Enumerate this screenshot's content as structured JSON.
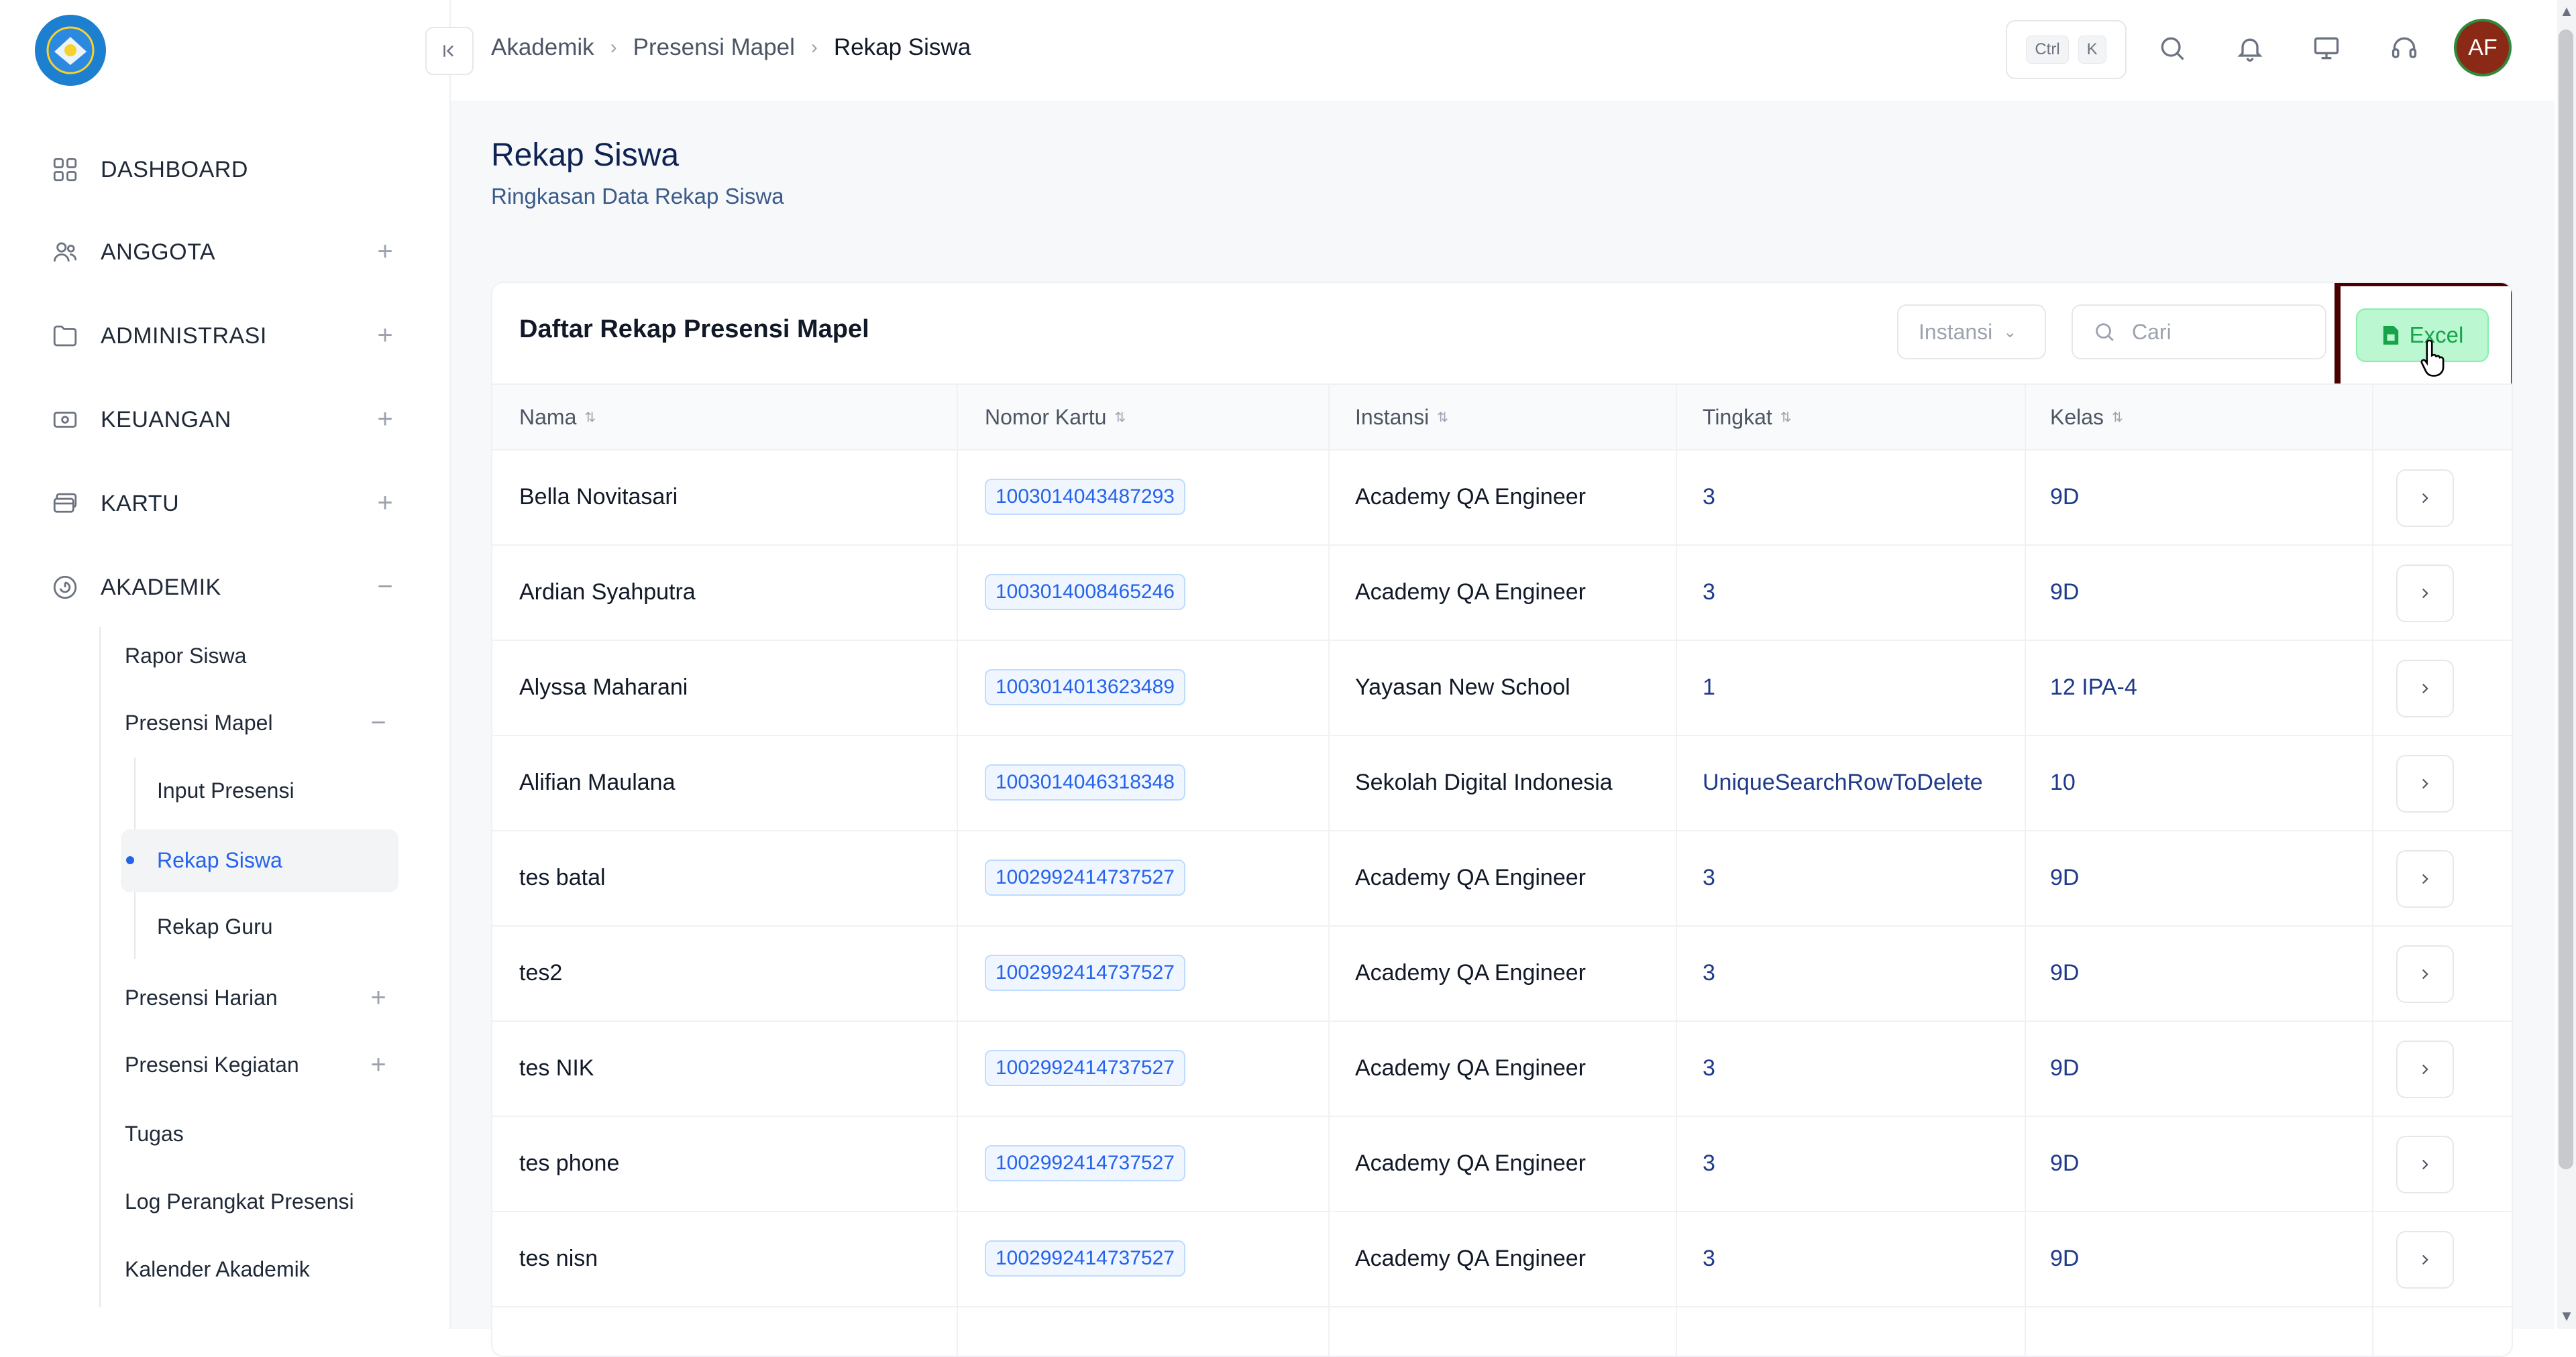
{
  "breadcrumb": [
    "Akademik",
    "Presensi Mapel",
    "Rekap Siswa"
  ],
  "topbar": {
    "kbd_ctrl": "Ctrl",
    "kbd_k": "K",
    "avatar_initials": "AF"
  },
  "sidebar": {
    "items": [
      {
        "label": "DASHBOARD",
        "icon": "grid-icon"
      },
      {
        "label": "ANGGOTA",
        "icon": "users-icon",
        "expand": "+"
      },
      {
        "label": "ADMINISTRASI",
        "icon": "folder-icon",
        "expand": "+"
      },
      {
        "label": "KEUANGAN",
        "icon": "money-icon",
        "expand": "+"
      },
      {
        "label": "KARTU",
        "icon": "card-icon",
        "expand": "+"
      },
      {
        "label": "AKADEMIK",
        "icon": "academic-icon",
        "expand": "−"
      }
    ],
    "akademik_sub": [
      {
        "label": "Rapor Siswa"
      },
      {
        "label": "Presensi Mapel",
        "expand": "−"
      },
      {
        "label": "Presensi Harian",
        "expand": "+"
      },
      {
        "label": "Presensi Kegiatan",
        "expand": "+"
      },
      {
        "label": "Tugas"
      },
      {
        "label": "Log Perangkat Presensi"
      },
      {
        "label": "Kalender Akademik"
      }
    ],
    "presensi_mapel_sub": [
      {
        "label": "Input Presensi"
      },
      {
        "label": "Rekap Siswa",
        "active": true
      },
      {
        "label": "Rekap Guru"
      }
    ]
  },
  "page": {
    "title": "Rekap Siswa",
    "subtitle": "Ringkasan Data Rekap Siswa"
  },
  "card": {
    "title": "Daftar Rekap Presensi Mapel",
    "filter_placeholder": "Instansi",
    "search_placeholder": "Cari",
    "excel_label": "Excel"
  },
  "table": {
    "columns": [
      "Nama",
      "Nomor Kartu",
      "Instansi",
      "Tingkat",
      "Kelas"
    ],
    "rows": [
      {
        "nama": "Bella Novitasari",
        "nomor_kartu": "1003014043487293",
        "instansi": "Academy QA Engineer",
        "tingkat": "3",
        "kelas": "9D"
      },
      {
        "nama": "Ardian Syahputra",
        "nomor_kartu": "1003014008465246",
        "instansi": "Academy QA Engineer",
        "tingkat": "3",
        "kelas": "9D"
      },
      {
        "nama": "Alyssa Maharani",
        "nomor_kartu": "1003014013623489",
        "instansi": "Yayasan New School",
        "tingkat": "1",
        "kelas": "12 IPA-4"
      },
      {
        "nama": "Alifian Maulana",
        "nomor_kartu": "1003014046318348",
        "instansi": "Sekolah Digital Indonesia",
        "tingkat": "UniqueSearchRowToDelete",
        "kelas": "10"
      },
      {
        "nama": "tes batal",
        "nomor_kartu": "1002992414737527",
        "instansi": "Academy QA Engineer",
        "tingkat": "3",
        "kelas": "9D"
      },
      {
        "nama": "tes2",
        "nomor_kartu": "1002992414737527",
        "instansi": "Academy QA Engineer",
        "tingkat": "3",
        "kelas": "9D"
      },
      {
        "nama": "tes NIK",
        "nomor_kartu": "1002992414737527",
        "instansi": "Academy QA Engineer",
        "tingkat": "3",
        "kelas": "9D"
      },
      {
        "nama": "tes phone",
        "nomor_kartu": "1002992414737527",
        "instansi": "Academy QA Engineer",
        "tingkat": "3",
        "kelas": "9D"
      },
      {
        "nama": "tes nisn",
        "nomor_kartu": "1002992414737527",
        "instansi": "Academy QA Engineer",
        "tingkat": "3",
        "kelas": "9D"
      }
    ]
  },
  "colors": {
    "accent": "#2563eb",
    "excel_green": "#16a34a",
    "highlight": "#4a0000",
    "title_navy": "#0f2352"
  }
}
